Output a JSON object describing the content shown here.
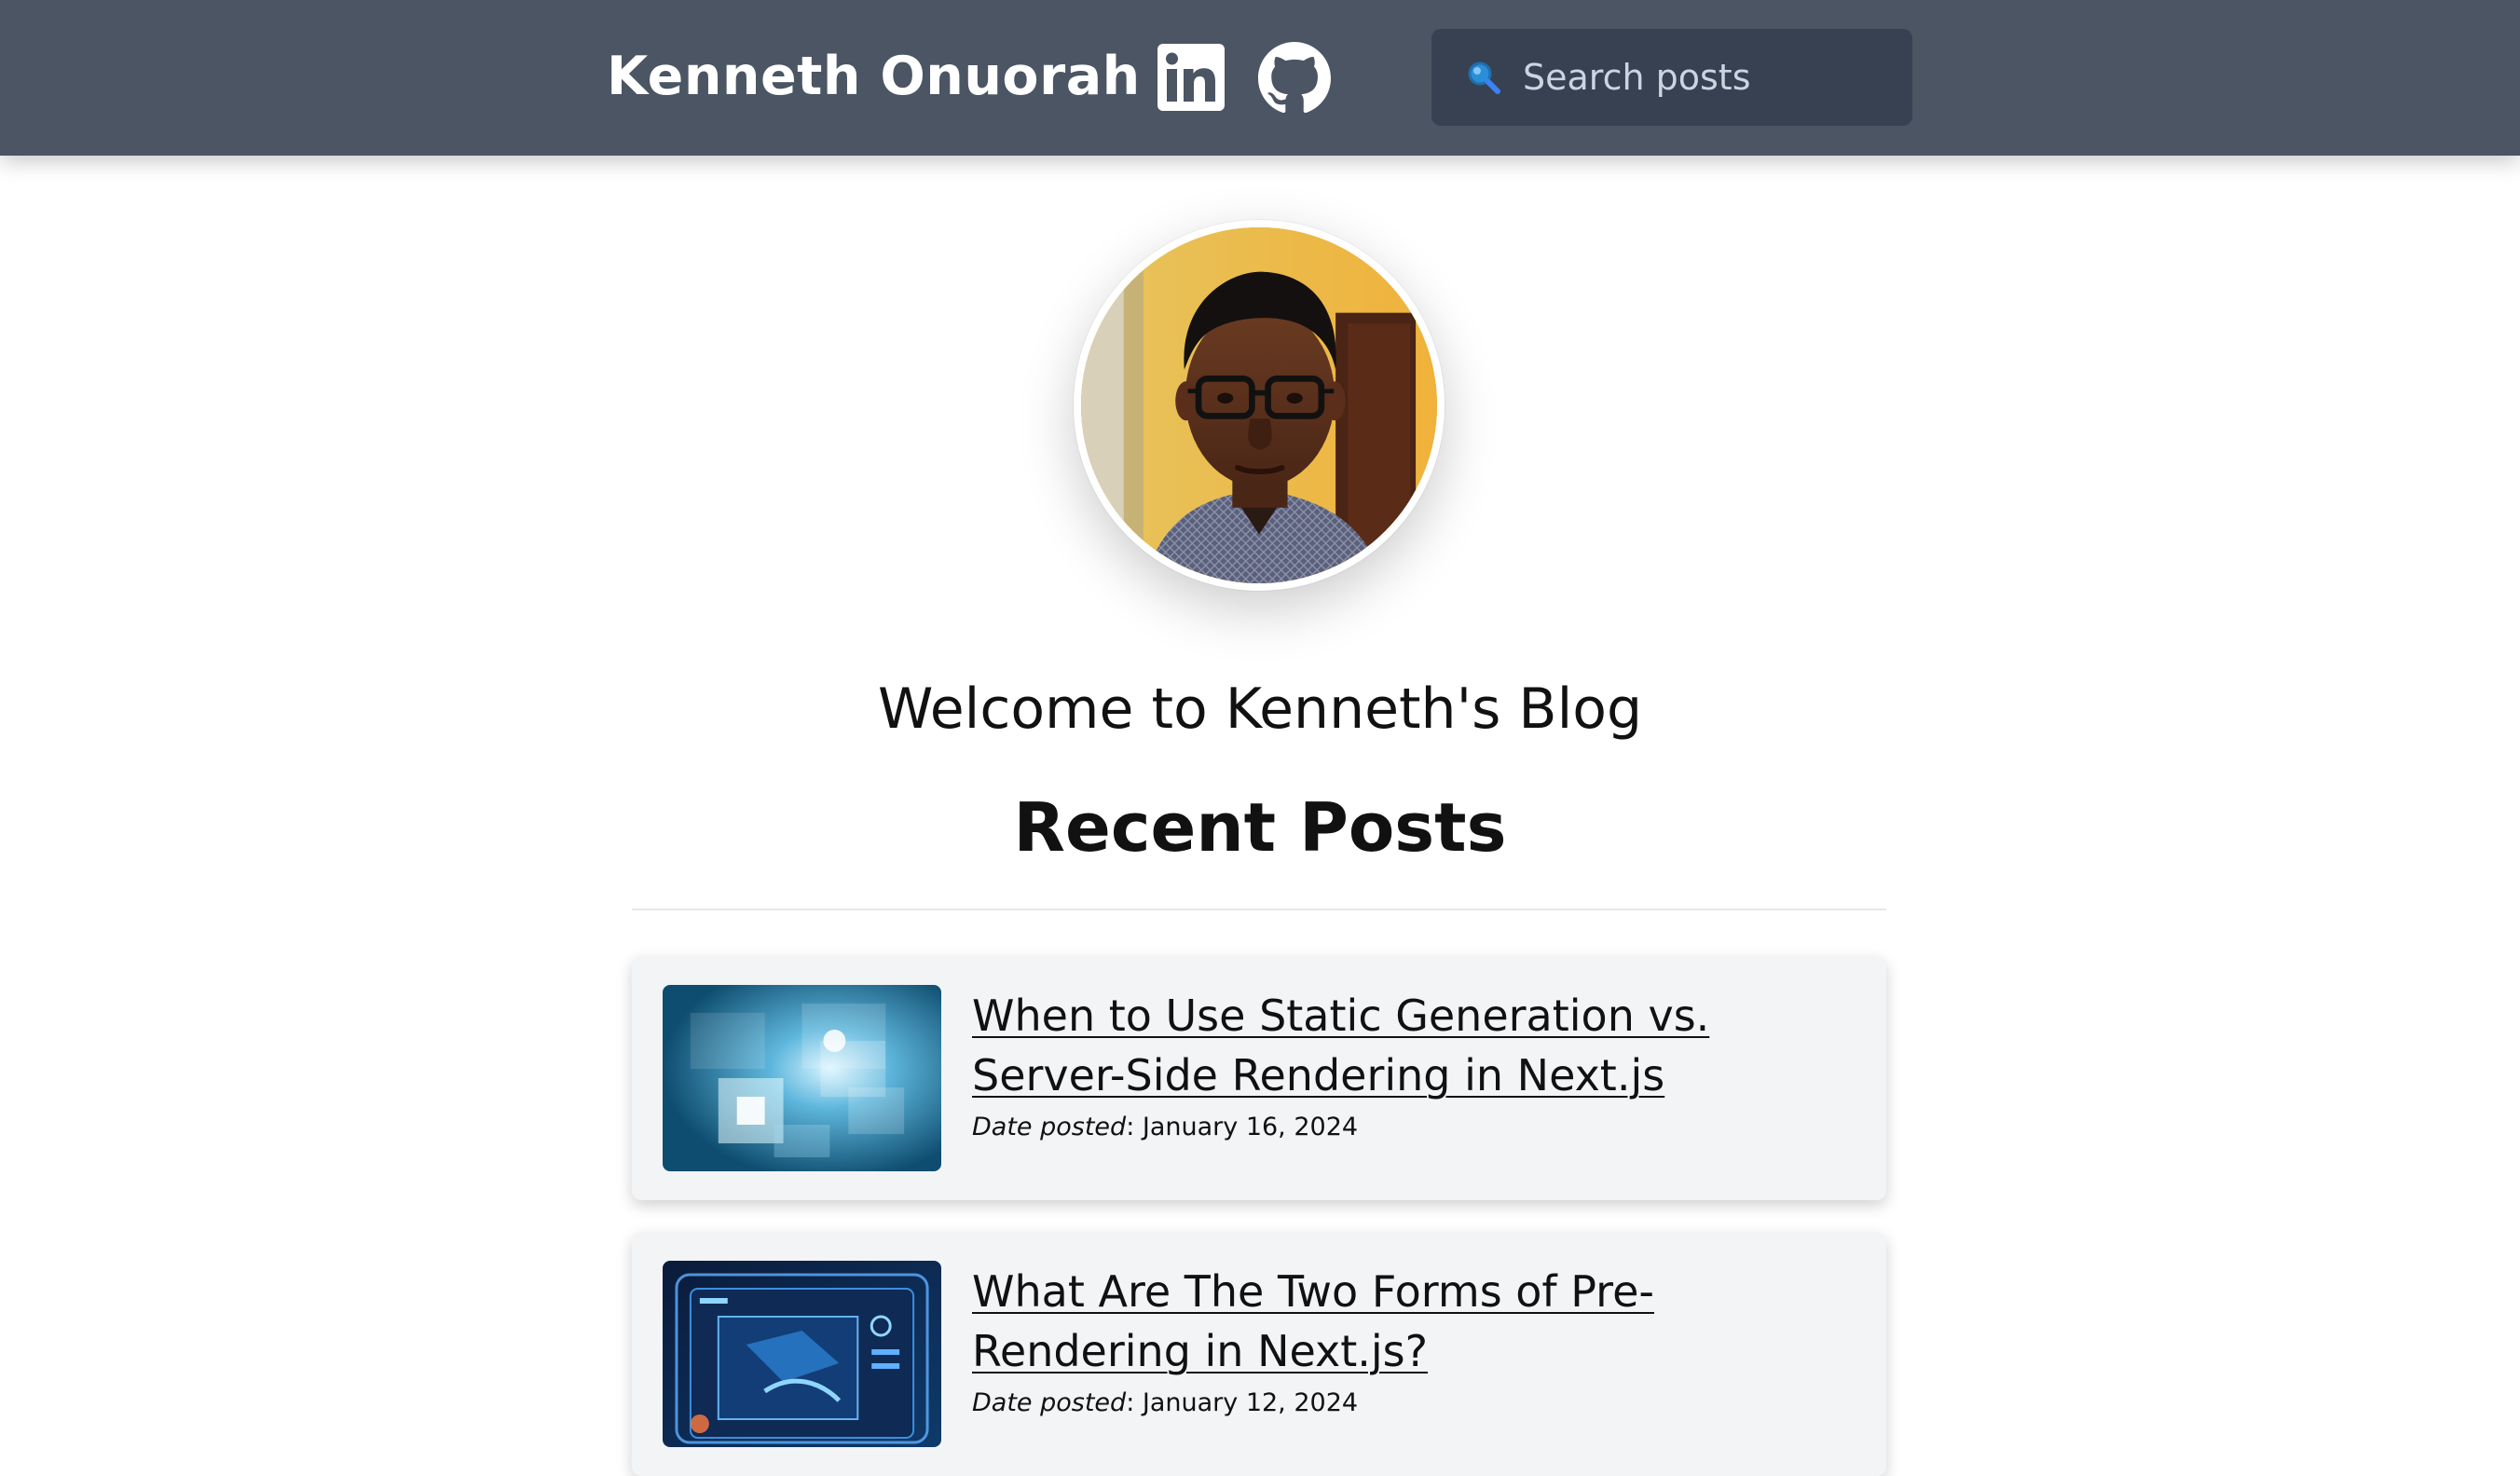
{
  "header": {
    "brand": "Kenneth Onuorah",
    "social": [
      {
        "name": "linkedin",
        "icon": "linkedin-icon"
      },
      {
        "name": "github",
        "icon": "github-icon"
      }
    ],
    "search": {
      "placeholder": "Search posts",
      "value": "",
      "icon": "search-icon"
    }
  },
  "hero": {
    "welcome": "Welcome to Kenneth's Blog",
    "recent_heading": "Recent Posts"
  },
  "posts": [
    {
      "title": "When to Use Static Generation vs. Server-Side Rendering in Next.js",
      "date_label": "Date posted",
      "date": "January 16, 2024"
    },
    {
      "title": "What Are The Two Forms of Pre-Rendering in Next.js?",
      "date_label": "Date posted",
      "date": "January 12, 2024"
    }
  ],
  "colors": {
    "header_bg": "#4b5563",
    "search_bg": "#374151",
    "card_bg": "#f3f4f6"
  }
}
